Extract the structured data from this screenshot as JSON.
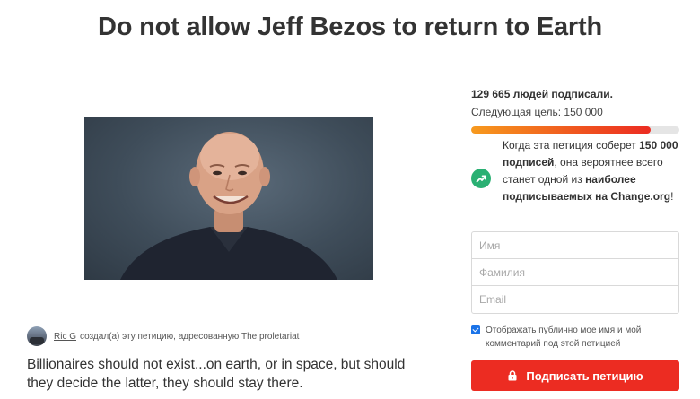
{
  "petition": {
    "title": "Do not allow Jeff Bezos to return to Earth",
    "author_name": "Ric G",
    "author_action": "создал(а) эту петицию, адресованную",
    "recipient": "The proletariat",
    "description": "Billionaires should not exist...on earth, or in space, but should they decide the latter, they should stay there."
  },
  "stats": {
    "signed_text": "129 665 людей подписали.",
    "goal_text": "Следующая цель: 150 000",
    "progress_fraction": 0.86
  },
  "info": {
    "part1": "Когда эта петиция соберет ",
    "bold1": "150 000 подписей",
    "part2": ", она вероятнее всего станет одной из ",
    "bold2": "наиболее подписываемых на Change.org",
    "part3": "!",
    "icon": "trending-up-icon"
  },
  "form": {
    "first_name_placeholder": "Имя",
    "last_name_placeholder": "Фамилия",
    "email_placeholder": "Email",
    "consent_label": "Отображать публично мое имя и мой комментарий под этой петицией",
    "consent_checked": true,
    "sign_button_label": "Подписать петицию"
  },
  "colors": {
    "accent": "#ec2c22",
    "progress_start": "#f79a1e",
    "info_icon": "#2ab073",
    "checkbox": "#1a73e8"
  }
}
